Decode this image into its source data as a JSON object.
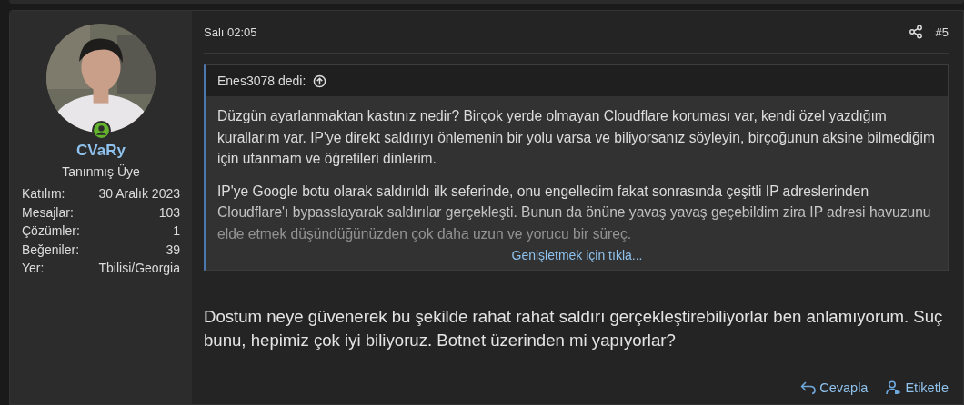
{
  "author": {
    "name": "CVaRy",
    "title": "Tanınmış Üye",
    "online": true,
    "stats": [
      {
        "label": "Katılım:",
        "value": "30 Aralık 2023"
      },
      {
        "label": "Mesajlar:",
        "value": "103"
      },
      {
        "label": "Çözümler:",
        "value": "1"
      },
      {
        "label": "Beğeniler:",
        "value": "39"
      },
      {
        "label": "Yer:",
        "value": "Tbilisi/Georgia"
      }
    ]
  },
  "post": {
    "date": "Salı 02:05",
    "number": "#5",
    "quote": {
      "header": "Enes3078 dedi:",
      "paragraphs": [
        "Düzgün ayarlanmaktan kastınız nedir? Birçok yerde olmayan Cloudflare koruması var, kendi özel yazdığım kurallarım var. IP'ye direkt saldırıyı önlemenin bir yolu varsa ve biliyorsanız söyleyin, birçoğunun aksine bilmediğim için utanmam ve öğretileri dinlerim.",
        "IP'ye Google botu olarak saldırıldı ilk seferinde, onu engelledim fakat sonrasında çeşitli IP adreslerinden Cloudflare'ı bypasslayarak saldırılar gerçekleşti. Bunun da önüne yavaş yavaş geçebildim zira IP adresi havuzunu elde etmek düşündüğünüzden çok daha uzun ve yorucu bir süreç."
      ],
      "expand": "Genişletmek için tıkla..."
    },
    "body": "Dostum neye güvenerek bu şekilde rahat rahat saldırı gerçekleştirebiliyorlar ben anlamıyorum. Suç bunu, hepimiz çok iyi biliyoruz. Botnet üzerinden mi yapıyorlar?",
    "actions": [
      {
        "kind": "reply",
        "label": "Cevapla"
      },
      {
        "kind": "tag",
        "label": "Etiketle"
      }
    ]
  }
}
